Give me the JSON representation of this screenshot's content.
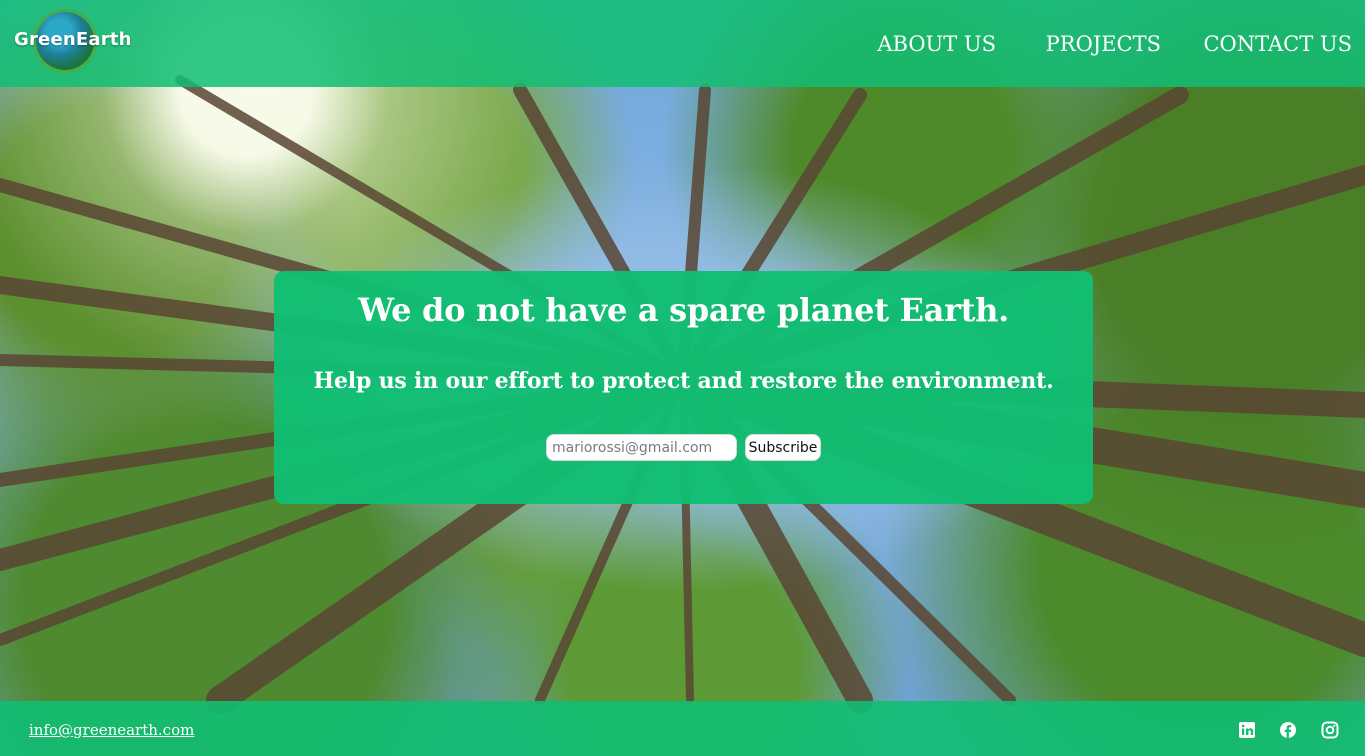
{
  "brand": {
    "logo_text": "GreenEarth"
  },
  "nav": {
    "items": [
      {
        "label": "ABOUT US"
      },
      {
        "label": "PROJECTS"
      },
      {
        "label": "CONTACT US"
      }
    ]
  },
  "hero": {
    "headline": "We do not have a spare planet Earth.",
    "subheadline": "Help us in our effort to protect and restore the environment.",
    "email_placeholder": "mariorossi@gmail.com",
    "subscribe_label": "Subscribe"
  },
  "footer": {
    "email": "info@greenearth.com",
    "social": [
      {
        "icon": "linkedin-icon"
      },
      {
        "icon": "facebook-icon"
      },
      {
        "icon": "instagram-icon"
      }
    ]
  },
  "colors": {
    "accent_green": "#11be73",
    "text_white": "#ffffff"
  }
}
